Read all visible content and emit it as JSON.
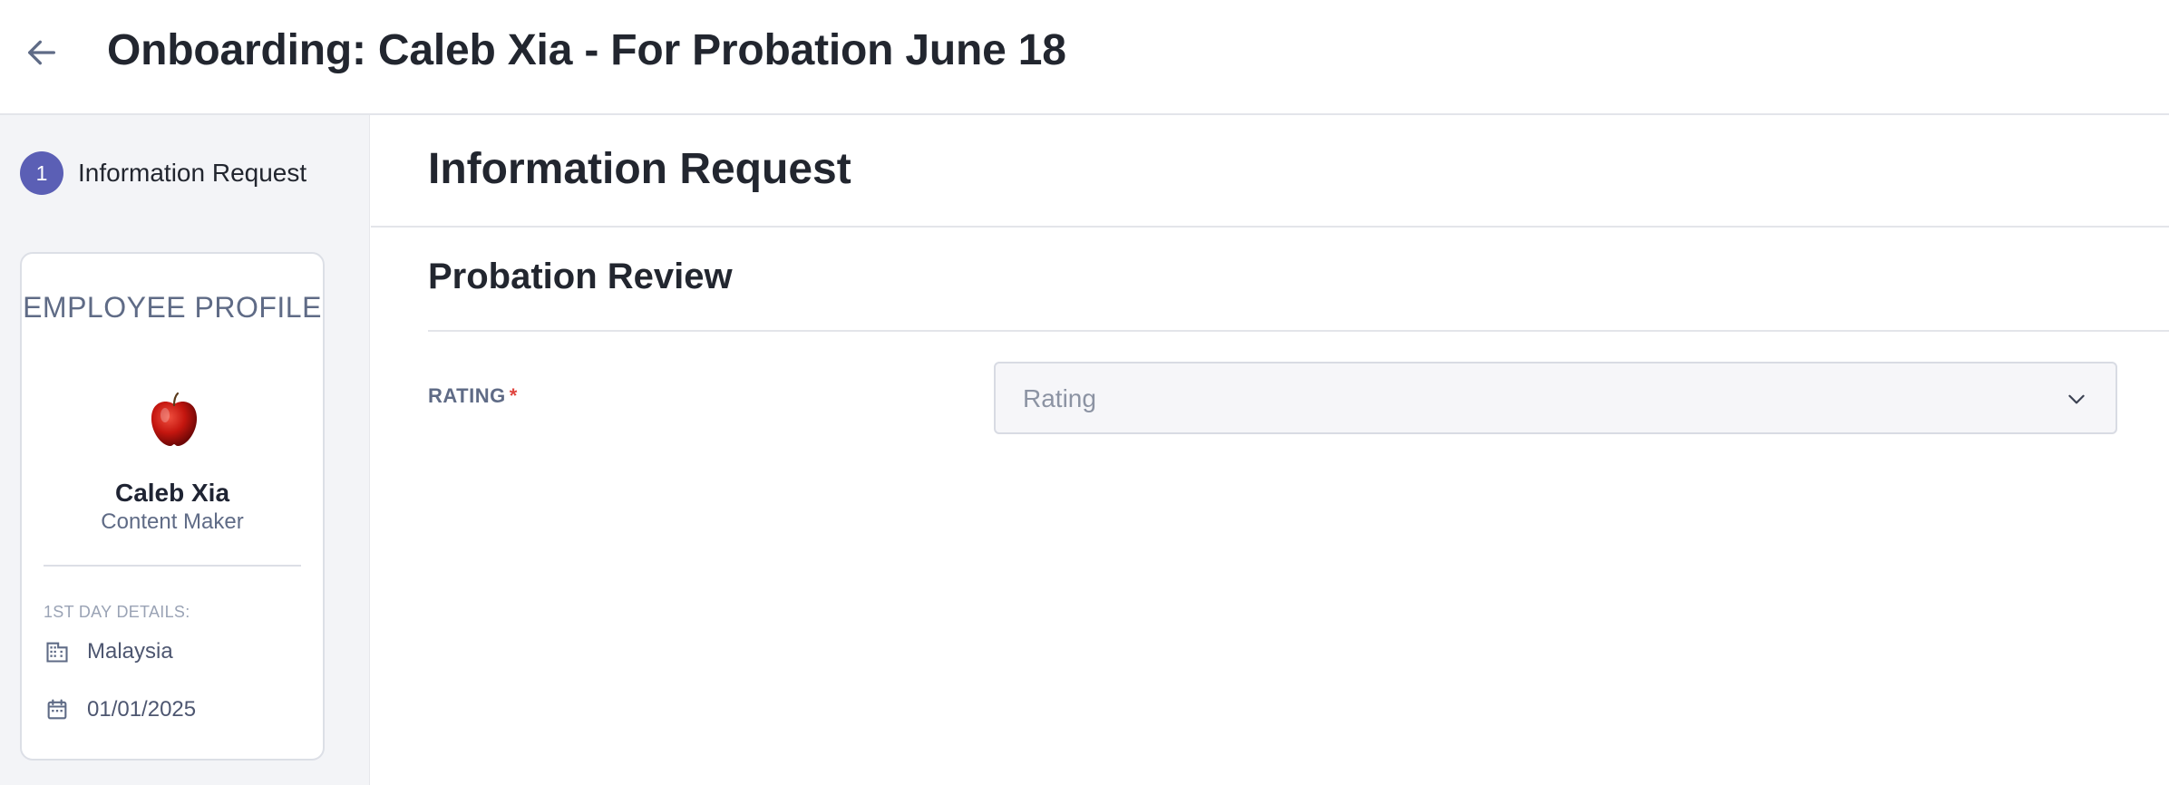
{
  "header": {
    "back_icon": "arrow-left-icon",
    "title": "Onboarding: Caleb Xia - For Probation June 18"
  },
  "sidebar": {
    "steps": [
      {
        "number": "1",
        "label": "Information Request",
        "active": true
      }
    ],
    "profile": {
      "title": "EMPLOYEE PROFILE",
      "avatar": "apple-avatar",
      "name": "Caleb Xia",
      "role": "Content Maker",
      "details_label": "1ST DAY DETAILS:",
      "details": [
        {
          "icon": "building-icon",
          "value": "Malaysia"
        },
        {
          "icon": "calendar-icon",
          "value": "01/01/2025"
        }
      ]
    }
  },
  "main": {
    "section_title": "Information Request",
    "subsection_title": "Probation Review",
    "fields": [
      {
        "label": "RATING",
        "required_mark": "*",
        "placeholder": "Rating",
        "value": ""
      }
    ]
  },
  "colors": {
    "accent": "#5b5fb5",
    "required": "#e0453f",
    "sidebar_bg": "#f3f4f7"
  }
}
